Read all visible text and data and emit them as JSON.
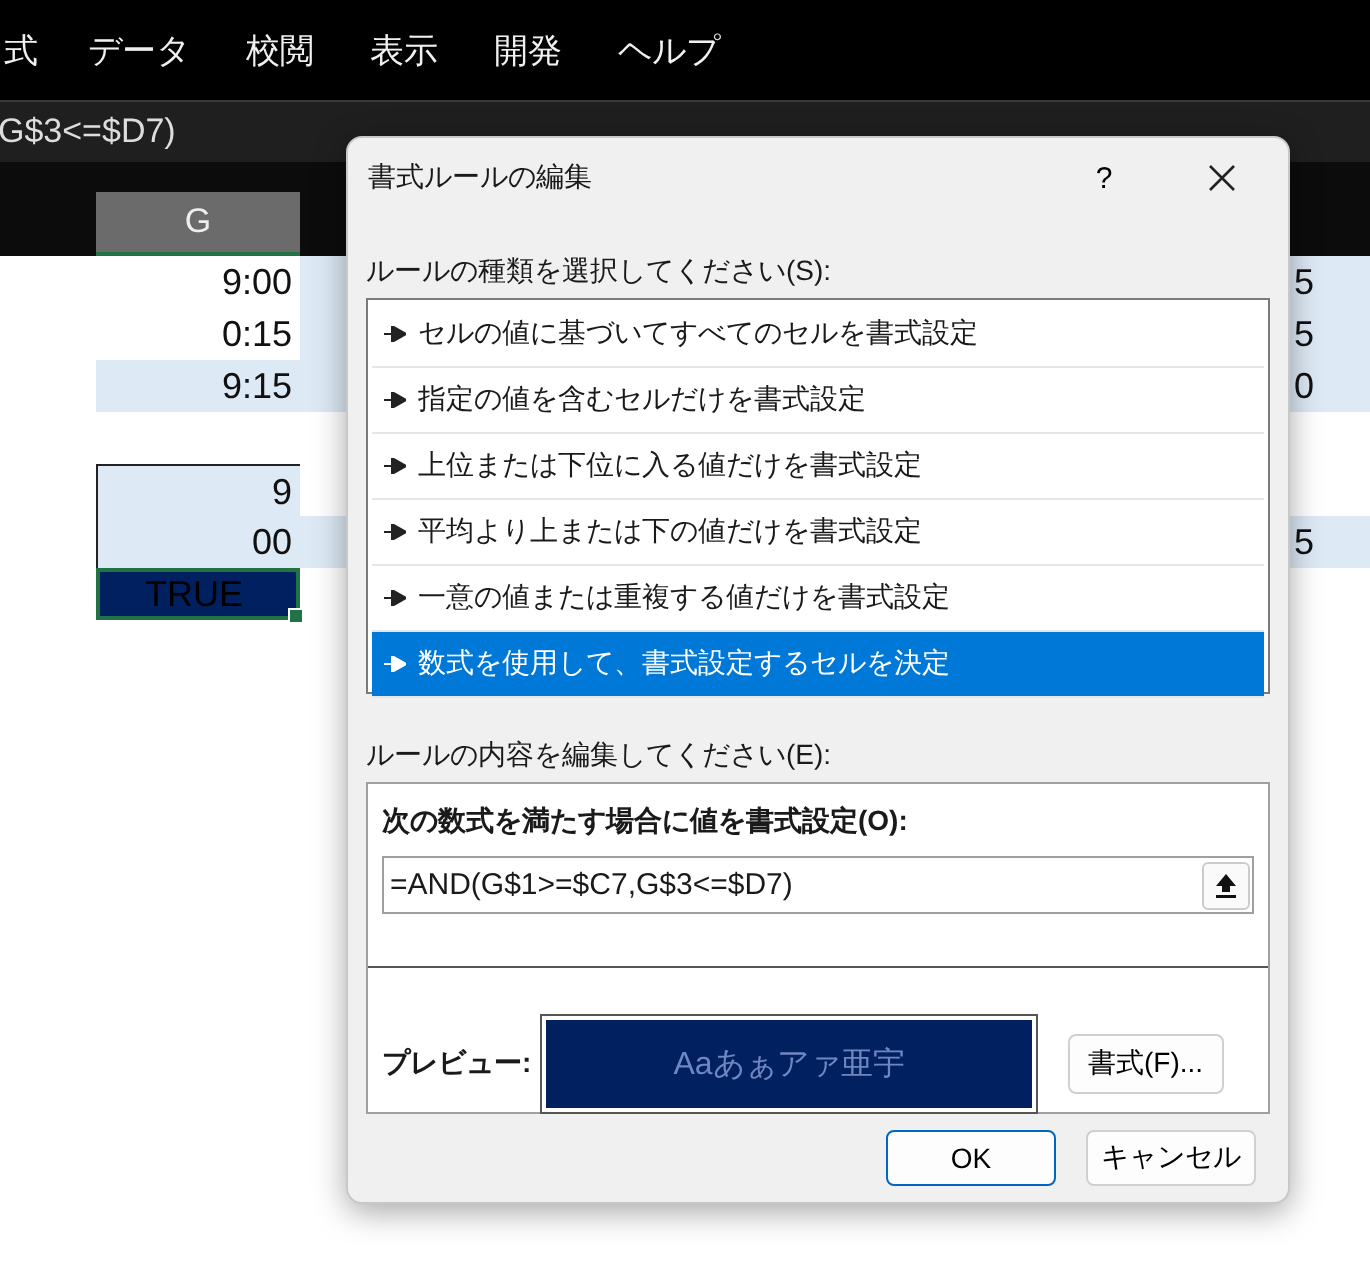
{
  "ribbon": {
    "tabs": [
      "式",
      "データ",
      "校閲",
      "表示",
      "開発",
      "ヘルプ"
    ]
  },
  "formula_bar": {
    "text": "G$3<=$D7)"
  },
  "sheet": {
    "column_header": {
      "label": "G",
      "selected": true
    },
    "rows": [
      {
        "kind": "plain",
        "column_g": "9:00",
        "column_h": "5",
        "h_shaded": true
      },
      {
        "kind": "plain",
        "column_g": "0:15",
        "column_h": "5",
        "h_shaded": true
      },
      {
        "kind": "shaded",
        "column_g": "9:15",
        "column_h": "0",
        "h_shaded": true
      },
      {
        "kind": "blank",
        "h_shaded": false
      },
      {
        "kind": "boxed",
        "column_g": "9",
        "h_shaded": false
      },
      {
        "kind": "boxed",
        "column_g": "00",
        "column_h": "5",
        "h_shaded": true
      },
      {
        "kind": "active",
        "column_g": "TRUE",
        "h_shaded": false
      }
    ]
  },
  "dialog": {
    "title": "書式ルールの編集",
    "help": "?",
    "rule_type_label": "ルールの種類を選択してください(S):",
    "rule_types": [
      {
        "label": "セルの値に基づいてすべてのセルを書式設定",
        "selected": false
      },
      {
        "label": "指定の値を含むセルだけを書式設定",
        "selected": false
      },
      {
        "label": "上位または下位に入る値だけを書式設定",
        "selected": false
      },
      {
        "label": "平均より上または下の値だけを書式設定",
        "selected": false
      },
      {
        "label": "一意の値または重複する値だけを書式設定",
        "selected": false
      },
      {
        "label": "数式を使用して、書式設定するセルを決定",
        "selected": true
      }
    ],
    "edit_label": "ルールの内容を編集してください(E):",
    "formula_label": "次の数式を満たす場合に値を書式設定(O):",
    "formula": "=AND(G$1>=$C7,G$3<=$D7)",
    "preview_label": "プレビュー:",
    "preview_sample": "Aaあぁアァ亜宇",
    "format_button": "書式(F)...",
    "buttons": [
      {
        "label": "OK",
        "default": true
      },
      {
        "label": "キャンセル",
        "default": false
      }
    ]
  }
}
